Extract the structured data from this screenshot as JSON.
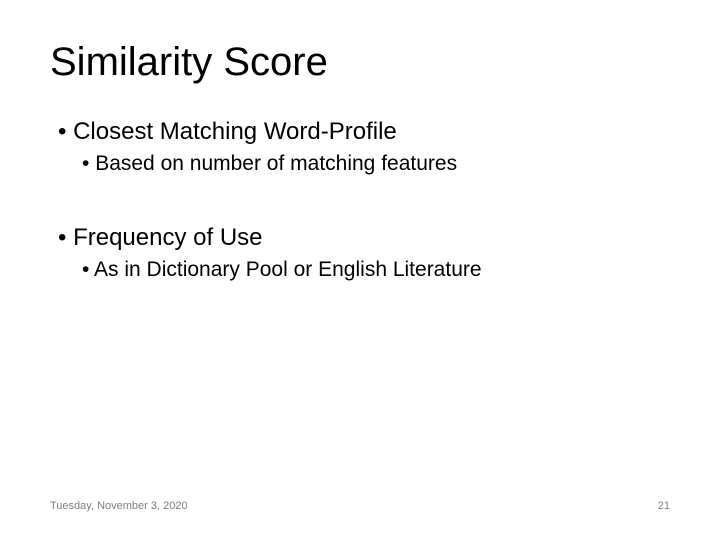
{
  "title": "Similarity Score",
  "bullets": {
    "l1a": "Closest Matching Word-Profile",
    "l2a": "Based on number of matching features",
    "l1b": "Frequency of Use",
    "l2b": "As in Dictionary Pool or English Literature"
  },
  "footer": {
    "date": "Tuesday, November 3, 2020",
    "page": "21"
  }
}
